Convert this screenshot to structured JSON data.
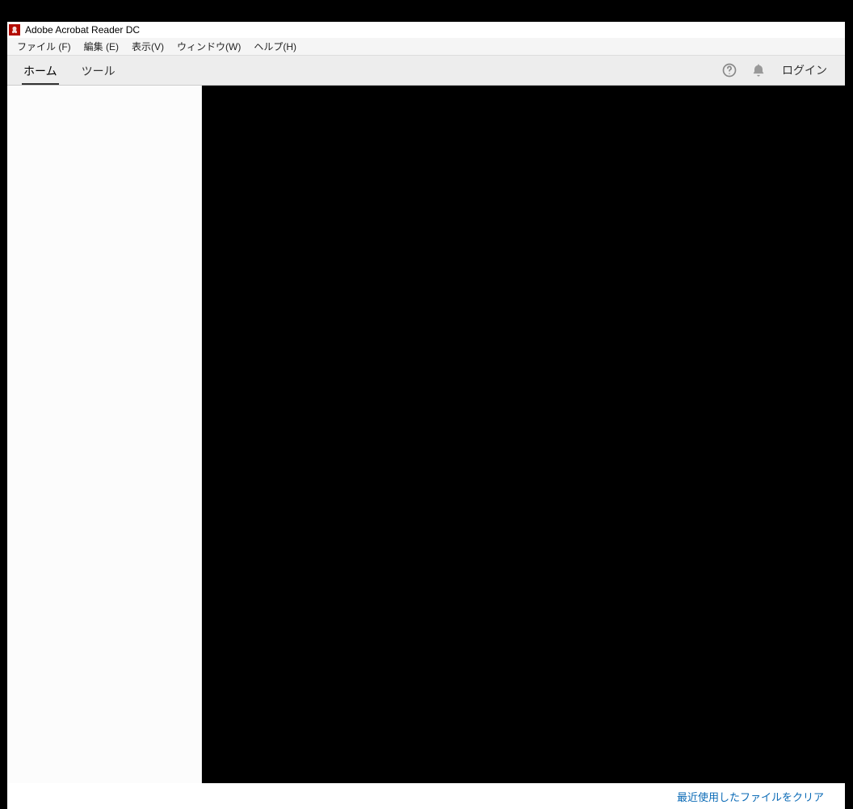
{
  "titlebar": {
    "app_title": "Adobe Acrobat Reader DC"
  },
  "menubar": {
    "items": [
      "ファイル (F)",
      "編集 (E)",
      "表示(V)",
      "ウィンドウ(W)",
      "ヘルプ(H)"
    ]
  },
  "toolbar": {
    "tabs": [
      {
        "label": "ホーム",
        "active": true
      },
      {
        "label": "ツール",
        "active": false
      }
    ],
    "login_label": "ログイン"
  },
  "footer": {
    "clear_recent_label": "最近使用したファイルをクリア"
  },
  "icons": {
    "help": "help-icon",
    "bell": "bell-icon",
    "app": "acrobat-icon"
  }
}
